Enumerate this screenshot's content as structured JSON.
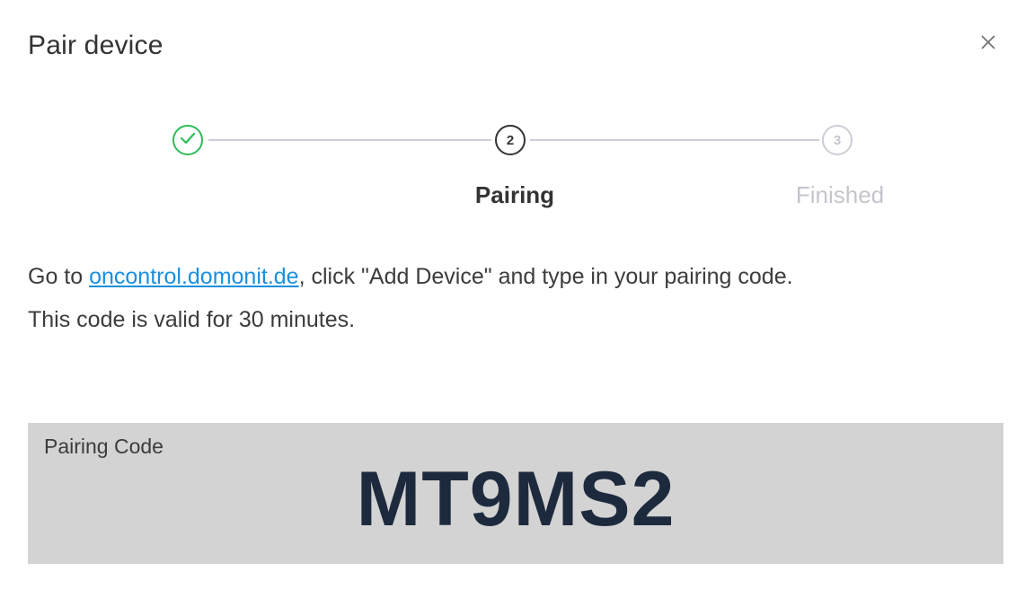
{
  "dialog": {
    "title": "Pair device",
    "close_icon": "close-icon"
  },
  "stepper": {
    "steps": [
      {
        "label": "",
        "number": "1",
        "status": "completed",
        "icon": "check-icon",
        "color": "#2ebd59"
      },
      {
        "label": "Pairing",
        "number": "2",
        "status": "active",
        "color": "#333333"
      },
      {
        "label": "Finished",
        "number": "3",
        "status": "pending",
        "color": "#c6c4cc"
      }
    ]
  },
  "instructions": {
    "prefix": "Go to ",
    "link_text": "oncontrol.domonit.de",
    "suffix": ", click \"Add Device\" and type in your pairing code.",
    "validity": "This code is valid for 30 minutes.",
    "link_color": "#1a8fe0"
  },
  "pairing": {
    "label": "Pairing Code",
    "code": "MT9MS2"
  }
}
